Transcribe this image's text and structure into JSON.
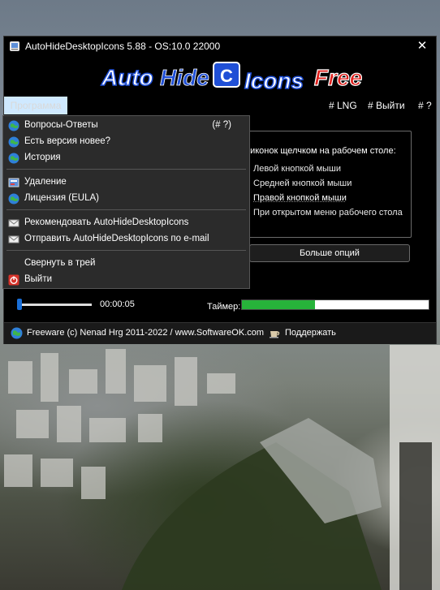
{
  "window": {
    "title": "AutoHideDesktopIcons 5.88 - OS:10.0 22000",
    "close": "✕"
  },
  "logo": {
    "auto": "Auto",
    "hide": "Hide",
    "icons": "Icons",
    "free": "Free"
  },
  "menubar": {
    "programma": "Программа",
    "lng": "# LNG",
    "exit": "# Выйти",
    "help": "# ?"
  },
  "dropdown": {
    "items": [
      {
        "label": "Вопросы-Ответы",
        "shortcut": "(# ?)",
        "icon": "globe-icon"
      },
      {
        "label": "Есть версия новее?",
        "icon": "globe-icon"
      },
      {
        "label": "История",
        "icon": "globe-icon"
      },
      {
        "label": "Удаление",
        "icon": "uninstall-icon"
      },
      {
        "label": "Лицензия (EULA)",
        "icon": "globe-icon"
      },
      {
        "label": "Рекомендовать AutoHideDesktopIcons",
        "icon": "envelope-icon"
      },
      {
        "label": "Отправить AutoHideDesktopIcons по e-mail",
        "icon": "envelope-icon"
      },
      {
        "label": "Свернуть в трей",
        "icon": ""
      },
      {
        "label": "Выйти",
        "icon": "power-icon"
      }
    ]
  },
  "options": {
    "legend": "аз иконок щелчком на рабочем столе:",
    "radios": [
      "Левой кнопкой мыши",
      "Средней кнопкой мыши",
      "Правой кнопкой мыши",
      "При открытом меню рабочего стола"
    ],
    "selected_index": 2,
    "more_button": "Больше опций"
  },
  "timer": {
    "time": "00:00:05",
    "label": "Таймер:",
    "progress": 0.39
  },
  "slider": {
    "value": 0.0
  },
  "status": {
    "freeware": "Freeware (c) Nenad Hrg 2011-2022 / www.SoftwareOK.com",
    "donate": "Поддержать"
  },
  "colors": {
    "accent_blue": "#1a6fd8",
    "timer_green": "#27b33a",
    "menu_highlight": "#cfe9ff",
    "logo_red": "#e0201c",
    "logo_blue": "#1f4fd6"
  }
}
